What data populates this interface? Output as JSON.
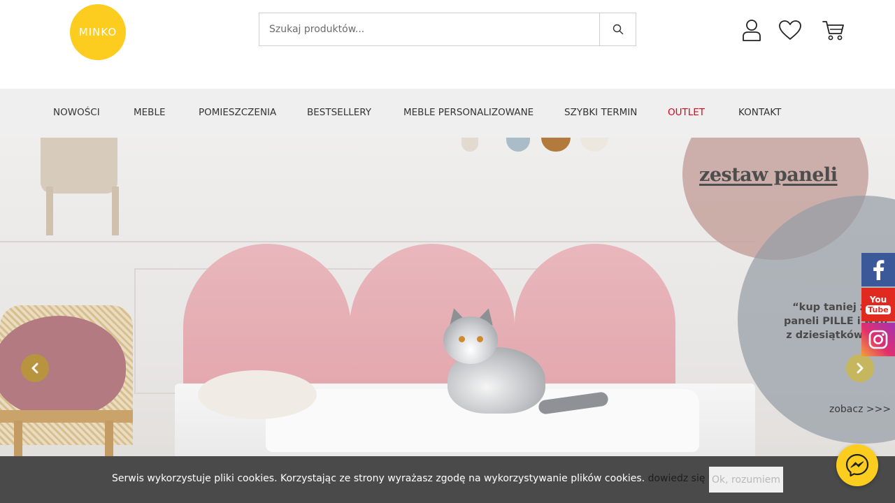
{
  "brand": {
    "logo_text": "MINKO",
    "logo_color": "#fccc1f"
  },
  "search": {
    "placeholder": "Szukaj produktów...",
    "icon": "search-icon"
  },
  "header_icons": [
    {
      "name": "user-icon"
    },
    {
      "name": "heart-icon"
    },
    {
      "name": "cart-icon"
    }
  ],
  "nav": {
    "items": [
      {
        "label": "NOWOŚCI"
      },
      {
        "label": "MEBLE"
      },
      {
        "label": "POMIESZCZENIA"
      },
      {
        "label": "BESTSELLERY"
      },
      {
        "label": "MEBLE PERSONALIZOWANE"
      },
      {
        "label": "SZYBKI TERMIN"
      },
      {
        "label": "OUTLET",
        "color": "#e4001b"
      },
      {
        "label": "KONTAKT"
      }
    ]
  },
  "hero": {
    "title": "zestaw paneli",
    "quote": "“kup taniej zes\npaneli PILLE i wyb\nz dziesiątków tka",
    "link": "zobacz >>>",
    "prev_icon": "chevron-left-icon",
    "next_icon": "chevron-right-icon"
  },
  "social": [
    {
      "name": "facebook-icon",
      "color": "#3b5998"
    },
    {
      "name": "youtube-icon",
      "color": "#e02a20",
      "label_top": "You",
      "label_bottom": "Tube"
    },
    {
      "name": "instagram-icon",
      "color": "#d62f5f"
    }
  ],
  "cookie": {
    "text": "Serwis wykorzystuje pliki cookies. Korzystając ze strony wyrażasz zgodę na wykorzystywanie plików cookies.",
    "link": "dowiedz się więcej.",
    "button": "Ok, rozumiem"
  },
  "messenger": {
    "icon": "messenger-icon"
  }
}
